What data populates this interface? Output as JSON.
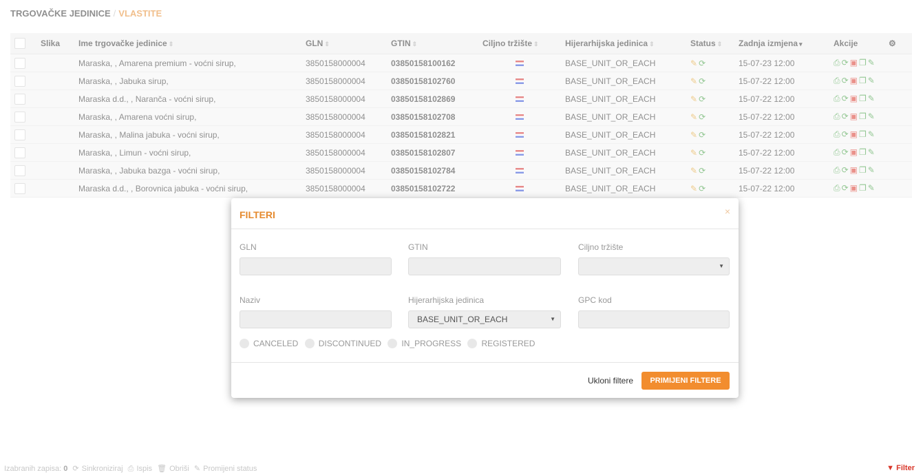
{
  "breadcrumb": {
    "parent": "TRGOVAČKE JEDINICE",
    "separator": "/",
    "current": "VLASTITE"
  },
  "table": {
    "headers": {
      "image": "Slika",
      "name": "Ime trgovačke jedinice",
      "gln": "GLN",
      "gtin": "GTIN",
      "market": "Ciljno tržište",
      "hierarchy": "Hijerarhijska jedinica",
      "status": "Status",
      "modified": "Zadnja izmjena",
      "actions": "Akcije"
    },
    "rows": [
      {
        "name": "Maraska, , Amarena premium - voćni sirup,",
        "gln": "3850158000004",
        "gtin": "03850158100162",
        "hierarchy": "BASE_UNIT_OR_EACH",
        "modified": "15-07-23 12:00"
      },
      {
        "name": "Maraska, , Jabuka sirup,",
        "gln": "3850158000004",
        "gtin": "03850158102760",
        "hierarchy": "BASE_UNIT_OR_EACH",
        "modified": "15-07-22 12:00"
      },
      {
        "name": "Maraska d.d., , Naranča - voćni sirup,",
        "gln": "3850158000004",
        "gtin": "03850158102869",
        "hierarchy": "BASE_UNIT_OR_EACH",
        "modified": "15-07-22 12:00"
      },
      {
        "name": "Maraska, , Amarena voćni sirup,",
        "gln": "3850158000004",
        "gtin": "03850158102708",
        "hierarchy": "BASE_UNIT_OR_EACH",
        "modified": "15-07-22 12:00"
      },
      {
        "name": "Maraska, , Malina jabuka - voćni sirup,",
        "gln": "3850158000004",
        "gtin": "03850158102821",
        "hierarchy": "BASE_UNIT_OR_EACH",
        "modified": "15-07-22 12:00"
      },
      {
        "name": "Maraska, , Limun - voćni sirup,",
        "gln": "3850158000004",
        "gtin": "03850158102807",
        "hierarchy": "BASE_UNIT_OR_EACH",
        "modified": "15-07-22 12:00"
      },
      {
        "name": "Maraska, , Jabuka bazga - voćni sirup,",
        "gln": "3850158000004",
        "gtin": "03850158102784",
        "hierarchy": "BASE_UNIT_OR_EACH",
        "modified": "15-07-22 12:00"
      },
      {
        "name": "Maraska d.d., , Borovnica jabuka - voćni sirup,",
        "gln": "3850158000004",
        "gtin": "03850158102722",
        "hierarchy": "BASE_UNIT_OR_EACH",
        "modified": "15-07-22 12:00"
      }
    ]
  },
  "modal": {
    "title": "FILTERI",
    "close": "×",
    "fields": {
      "gln_label": "GLN",
      "gtin_label": "GTIN",
      "market_label": "Ciljno tržište",
      "name_label": "Naziv",
      "hierarchy_label": "Hijerarhijska jedinica",
      "hierarchy_value": "BASE_UNIT_OR_EACH",
      "gpc_label": "GPC kod"
    },
    "statuses": [
      "CANCELED",
      "DISCONTINUED",
      "IN_PROGRESS",
      "REGISTERED"
    ],
    "clear_label": "Ukloni filtere",
    "apply_label": "PRIMIJENI FILTERE"
  },
  "footer": {
    "selected_label": "Izabranih zapisa:",
    "selected_count": "0",
    "sync_label": "Sinkroniziraj",
    "print_label": "Ispis",
    "delete_label": "Obriši",
    "status_label": "Promijeni status",
    "filter_label": "Filter"
  },
  "colors": {
    "accent": "#e58a2e",
    "button": "#f28d2e",
    "ok": "#3b9a3b",
    "danger": "#d9372a"
  }
}
